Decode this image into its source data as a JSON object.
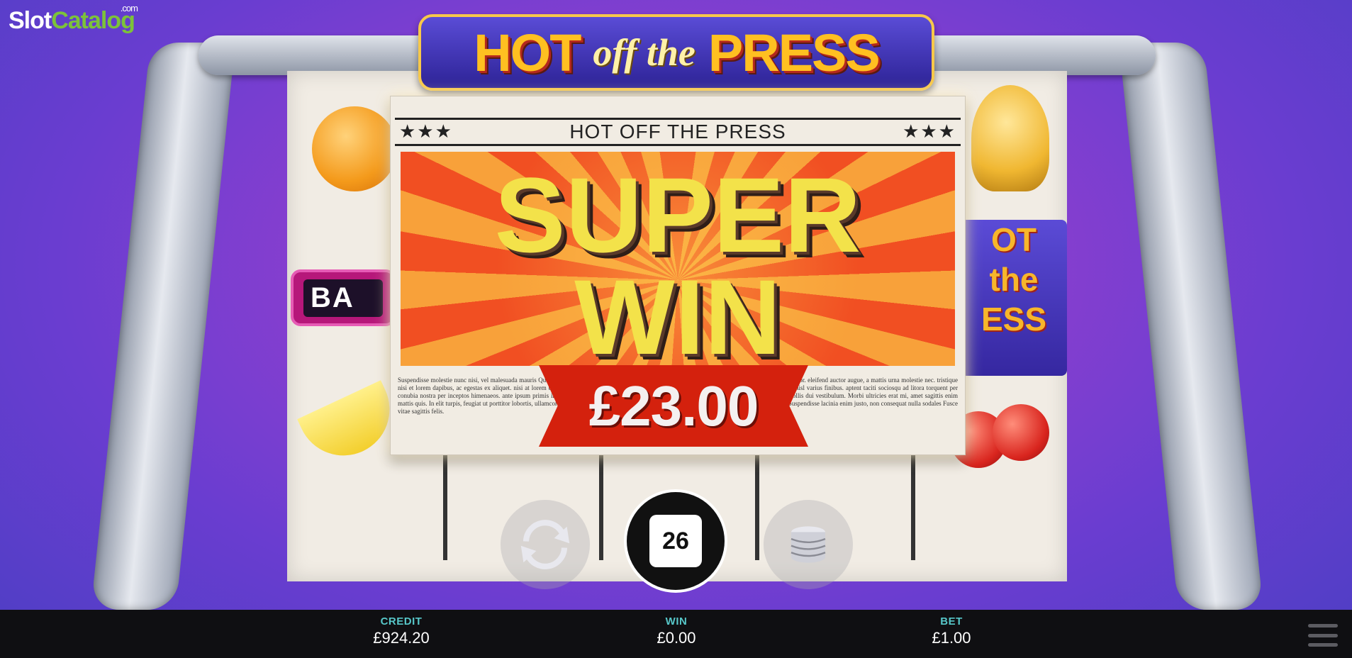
{
  "logo": {
    "part1": "Slot",
    "part2": "Catalog",
    "suffix": ".com"
  },
  "game": {
    "title_word1": "HOT",
    "title_word2": "off the",
    "title_word3": "PRESS",
    "symbols": {
      "bar": "BA",
      "hotpress": "OT\nthe\nESS"
    }
  },
  "win_popup": {
    "masthead": "HOT OFF THE PRESS",
    "stars_left": "★★★",
    "stars_right": "★★★",
    "headline1": "SUPER",
    "headline2": "WIN",
    "amount": "£23.00",
    "filler_text": "Suspendisse molestie nunc nisi, vel malesuada mauris Quisque vehicula, nisl eget efficitur semper, sapien imperdiet turpis, in fermentum justo justo nec dolor. eleifend auctor augue, a mattis urna molestie nec. tristique nisi et lorem dapibus, ac egestas ex aliquet. nisi at lorem blandit feugiat. Integer nec tortor ut nulla venenatis hendrerit feugiat. Praesent posuere erat at nisl varius finibus. aptent taciti sociosqu ad litora torquent per conubia nostra per inceptos himenaeos. ante ipsum primis in faucibus orci luctus et posuere cubilia curae; Donec maximus arcu lobortis feugiat, nec mollis dui vestibulum. Morbi ultricies erat mi, amet sagittis enim mattis quis. In elit turpis, feugiat ut porttitor lobortis, ullamcorper maximus turpis. Suspendisse malesuada turpis. Donec pulvinar vitae lectus id tempor. Suspendisse lacinia enim justo, non consequat nulla sodales Fusce vitae sagittis felis."
  },
  "controls": {
    "autoplay_icon": "autoplay-arrows-icon",
    "spin_count": "26",
    "bet_icon": "coin-stack-icon"
  },
  "status_bar": {
    "credit_label": "CREDIT",
    "credit_value": "£924.20",
    "win_label": "WIN",
    "win_value": "£0.00",
    "bet_label": "BET",
    "bet_value": "£1.00",
    "menu_icon": "hamburger-menu-icon"
  },
  "colors": {
    "accent_teal": "#57c7c9",
    "ribbon_red": "#d4210d",
    "title_gold": "#ffc021"
  }
}
